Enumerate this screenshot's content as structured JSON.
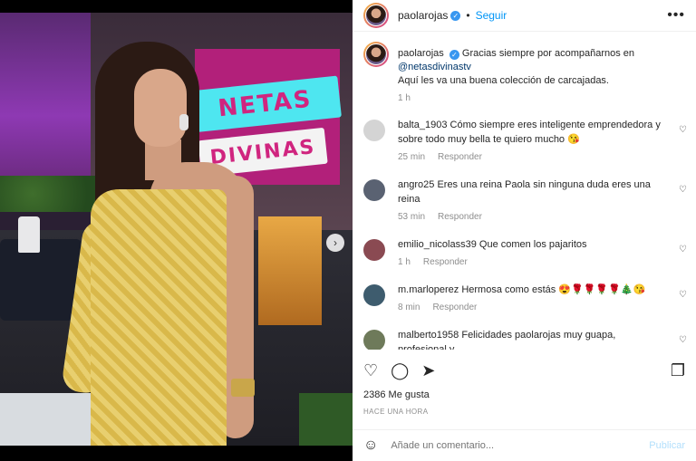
{
  "post": {
    "author": "paolarojas",
    "follow_label": "Seguir",
    "more_icon": "•••",
    "next_icon": "›",
    "sign_line1": "NETAS",
    "sign_line2": "DIVINAS"
  },
  "caption": {
    "user": "paolarojas",
    "text": "Gracias siempre por acompañarnos en",
    "mention": "@netasdivinastv",
    "text2": "Aquí les va una buena colección de carcajadas.",
    "time": "1 h"
  },
  "comments": [
    {
      "user": "balta_1903",
      "text": "Cómo siempre eres inteligente emprendedora y sobre todo muy bella te quiero mucho 😘",
      "time": "25 min",
      "reply": "Responder",
      "avatar_color": "#d4d4d4"
    },
    {
      "user": "angro25",
      "text": "Eres una reina Paola sin ninguna duda eres una reina",
      "time": "53 min",
      "reply": "Responder",
      "avatar_color": "#5a6272"
    },
    {
      "user": "emilio_nicolass39",
      "text": "Que comen los pajaritos",
      "time": "1 h",
      "reply": "Responder",
      "avatar_color": "#8a4a52"
    },
    {
      "user": "m.marloperez",
      "text": "Hermosa como estás 😍🌹🌹🌹🌹🎄😘",
      "time": "8 min",
      "reply": "Responder",
      "avatar_color": "#3e5c6e"
    },
    {
      "user": "malberto1958",
      "text": "Felicidades paolarojas muy guapa, profesional y",
      "time": "",
      "reply": "",
      "avatar_color": "#6e7a5a"
    }
  ],
  "actions": {
    "like_icon": "♡",
    "comment_icon": "◯",
    "share_icon": "➤",
    "save_icon": "❐",
    "heart_icon": "♡"
  },
  "likes": "2386 Me gusta",
  "timestamp": "HACE UNA HORA",
  "composer": {
    "emoji_icon": "☺",
    "placeholder": "Añade un comentario...",
    "publish_label": "Publicar"
  }
}
